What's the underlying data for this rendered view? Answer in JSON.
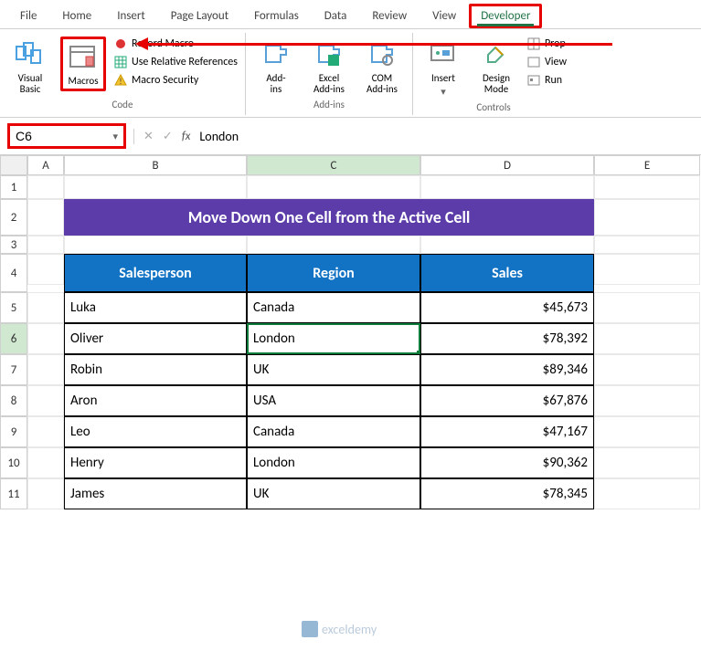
{
  "tabs": {
    "file": "File",
    "home": "Home",
    "insert": "Insert",
    "pagelayout": "Page Layout",
    "formulas": "Formulas",
    "data": "Data",
    "review": "Review",
    "view": "View",
    "developer": "Developer"
  },
  "ribbon": {
    "code": {
      "visual_basic": "Visual\nBasic",
      "macros": "Macros",
      "record": "Record Macro",
      "relative": "Use Relative References",
      "security": "Macro Security",
      "group": "Code"
    },
    "addins": {
      "addins": "Add-\nins",
      "excel": "Excel\nAdd-ins",
      "com": "COM\nAdd-ins",
      "group": "Add-ins"
    },
    "controls": {
      "insert": "Insert",
      "design": "Design\nMode",
      "prop": "Prop",
      "view": "View",
      "run": "Run",
      "group": "Controls"
    }
  },
  "namebox": {
    "ref": "C6",
    "fx": "fx",
    "value": "London"
  },
  "columns": {
    "A": "A",
    "B": "B",
    "C": "C",
    "D": "D",
    "E": "E"
  },
  "rows": [
    "1",
    "2",
    "3",
    "4",
    "5",
    "6",
    "7",
    "8",
    "9",
    "10",
    "11"
  ],
  "title": "Move Down One Cell from the Active Cell",
  "headers": {
    "salesperson": "Salesperson",
    "region": "Region",
    "sales": "Sales"
  },
  "chart_data": {
    "type": "table",
    "columns": [
      "Salesperson",
      "Region",
      "Sales"
    ],
    "rows": [
      {
        "salesperson": "Luka",
        "region": "Canada",
        "sales": "$45,673"
      },
      {
        "salesperson": "Oliver",
        "region": "London",
        "sales": "$78,392"
      },
      {
        "salesperson": "Robin",
        "region": "UK",
        "sales": "$89,346"
      },
      {
        "salesperson": "Aron",
        "region": "USA",
        "sales": "$67,876"
      },
      {
        "salesperson": "Leo",
        "region": "Canada",
        "sales": "$47,167"
      },
      {
        "salesperson": "Henry",
        "region": "London",
        "sales": "$90,362"
      },
      {
        "salesperson": "James",
        "region": "UK",
        "sales": "$78,345"
      }
    ]
  },
  "watermark": "exceldemy"
}
